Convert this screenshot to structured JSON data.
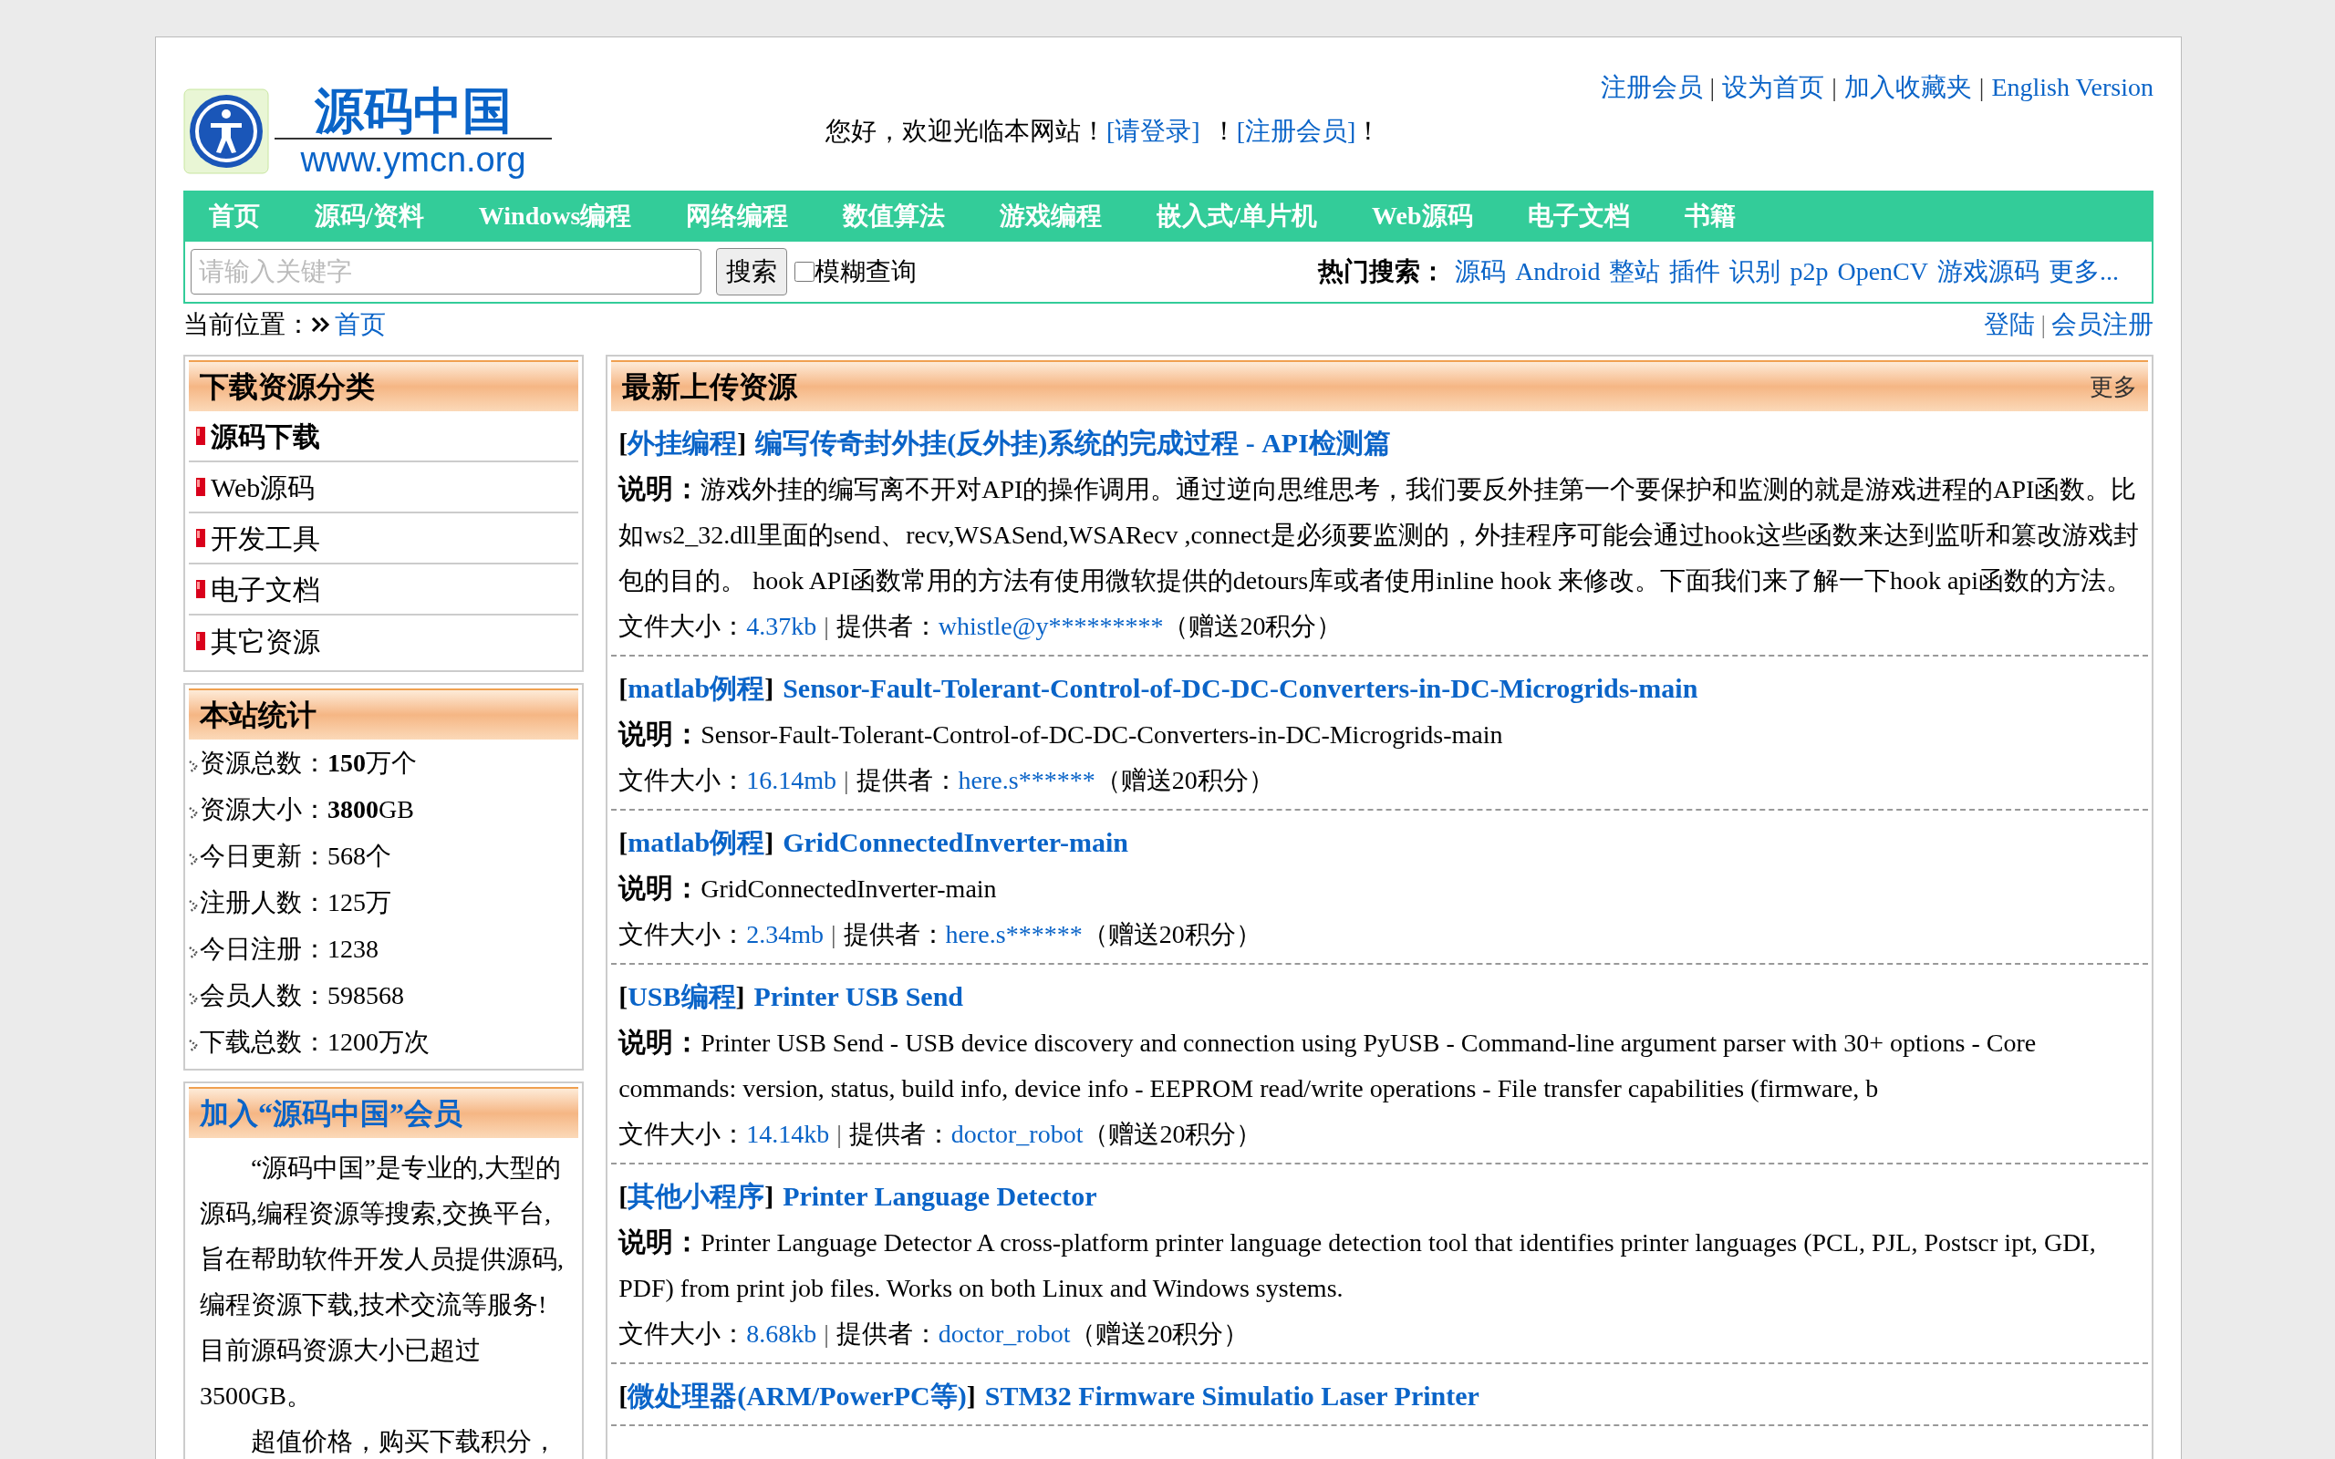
{
  "logo": {
    "title": "源码中国",
    "url": "www.ymcn.org"
  },
  "top_links": [
    {
      "label": "注册会员"
    },
    {
      "sep": "|",
      "label": "设为首页"
    },
    {
      "sep": "|",
      "label": "加入收藏夹"
    },
    {
      "sep": "|",
      "label": "English Version"
    }
  ],
  "welcome": {
    "before": "您好，欢迎光临本网站！",
    "login": "[请登录]",
    "middle": "！",
    "register": "[注册会员]",
    "after": "！"
  },
  "nav": [
    "首页",
    "源码/资料",
    "Windows编程",
    "网络编程",
    "数值算法",
    "游戏编程",
    "嵌入式/单片机",
    "Web源码",
    "电子文档",
    "书籍"
  ],
  "search": {
    "placeholder": "请输入关键字",
    "button": "搜索",
    "fuzzy": {
      "label": "模糊查询",
      "checked": false
    }
  },
  "hot": {
    "label": "热门搜索：",
    "items": [
      "源码",
      "Android",
      "整站",
      "插件",
      "识别",
      "p2p",
      "OpenCV",
      "游戏源码",
      "更多..."
    ]
  },
  "breadcrumb": {
    "label": "当前位置：",
    "items": [
      "首页"
    ]
  },
  "user_links": [
    {
      "label": "登陆"
    },
    {
      "sep": "|",
      "label": "会员注册"
    }
  ],
  "categories": {
    "title": "下载资源分类",
    "items": [
      {
        "label": "源码下载",
        "selected": true
      },
      {
        "label": "Web源码",
        "selected": false
      },
      {
        "label": "开发工具",
        "selected": false
      },
      {
        "label": "电子文档",
        "selected": false
      },
      {
        "label": "其它资源",
        "selected": false
      }
    ]
  },
  "stats": {
    "title": "本站统计",
    "items": [
      "资源总数：**150**万个",
      "资源大小：**3800**GB",
      "今日更新：568个",
      "注册人数：125万",
      "今日注册：1238",
      "会员人数：598568",
      "下载总数：1200万次"
    ]
  },
  "join": {
    "title": "加入“源码中国”会员",
    "paragraphs": [
      "“源码中国”是专业的,大型的源码,编程资源等搜索,交换平台,旨在帮助软件开发人员提供源码,编程资源下载,技术交流等服务!目前源码资源大小已超过3500GB。",
      "超值价格，购买下载积分，"
    ]
  },
  "latest": {
    "title": "最新上传资源",
    "more": "更多",
    "items": [
      {
        "open": "[",
        "close": "]",
        "desc_label": "说明：",
        "size_label": "文件大小：",
        "sep": "|",
        "provider_label": "提供者：",
        "category": "外挂编程",
        "title": "编写传奇封外挂(反外挂)系统的完成过程 - API检测篇",
        "desc": "游戏外挂的编写离不开对API的操作调用。通过逆向思维思考，我们要反外挂第一个要保护和监测的就是游戏进程的API函数。比如ws2_32.dll里面的send、recv,WSASend,WSARecv ,connect是必须要监测的，外挂程序可能会通过hook这些函数来达到监听和篡改游戏封包的目的。 hook API函数常用的方法有使用微软提供的detours库或者使用inline hook 来修改。下面我们来了解一下hook api函数的方法。",
        "size": "4.37kb",
        "provider": "whistle@y*********",
        "bonus": "（赠送20积分）"
      },
      {
        "open": "[",
        "close": "]",
        "desc_label": "说明：",
        "size_label": "文件大小：",
        "sep": "|",
        "provider_label": "提供者：",
        "category": "matlab例程",
        "title": "Sensor-Fault-Tolerant-Control-of-DC-DC-Converters-in-DC-Microgrids-main",
        "desc": "Sensor-Fault-Tolerant-Control-of-DC-DC-Converters-in-DC-Microgrids-main",
        "size": "16.14mb",
        "provider": "here.s******",
        "bonus": "（赠送20积分）"
      },
      {
        "open": "[",
        "close": "]",
        "desc_label": "说明：",
        "size_label": "文件大小：",
        "sep": "|",
        "provider_label": "提供者：",
        "category": "matlab例程",
        "title": "GridConnectedInverter-main",
        "desc": "GridConnectedInverter-main",
        "size": "2.34mb",
        "provider": "here.s******",
        "bonus": "（赠送20积分）"
      },
      {
        "open": "[",
        "close": "]",
        "desc_label": "说明：",
        "size_label": "文件大小：",
        "sep": "|",
        "provider_label": "提供者：",
        "category": "USB编程",
        "title": "Printer USB Send",
        "desc": "Printer USB Send - USB device discovery and connection using PyUSB - Command-line argument parser with 30+ options - Core commands: version, status, build info, device info - EEPROM read/write operations - File transfer capabilities (firmware, b",
        "size": "14.14kb",
        "provider": "doctor_robot",
        "bonus": "（赠送20积分）"
      },
      {
        "open": "[",
        "close": "]",
        "desc_label": "说明：",
        "size_label": "文件大小：",
        "sep": "|",
        "provider_label": "提供者：",
        "category": "其他小程序",
        "title": "Printer Language Detector",
        "desc": "Printer Language Detector A cross-platform printer language detection tool that identifies printer languages (PCL, PJL, Postscr ipt, GDI, PDF) from print job files. Works on both Linux and Windows systems.",
        "size": "8.68kb",
        "provider": "doctor_robot",
        "bonus": "（赠送20积分）"
      },
      {
        "open": "[",
        "close": "]",
        "category": "微处理器(ARM/PowerPC等)",
        "title": "STM32 Firmware Simulatio Laser Printer"
      }
    ]
  }
}
